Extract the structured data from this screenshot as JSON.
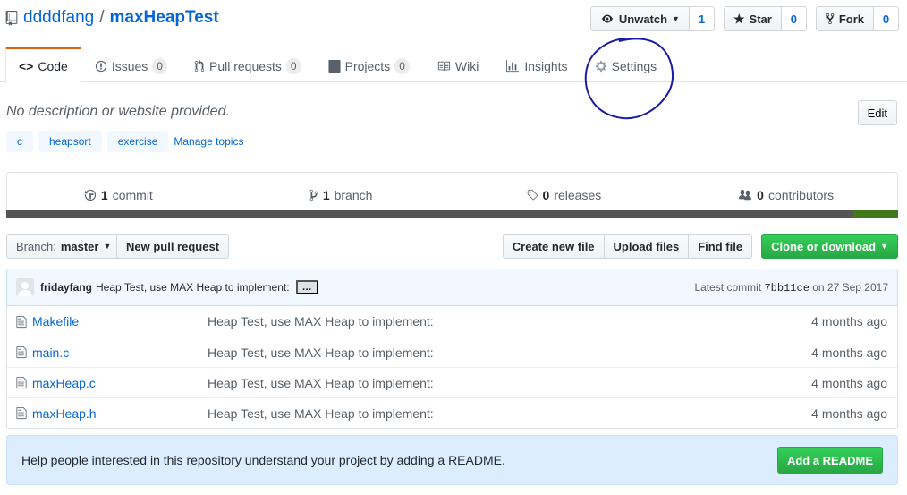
{
  "repo": {
    "owner": "ddddfang",
    "separator": "/",
    "name": "maxHeapTest"
  },
  "actions": {
    "unwatch": {
      "label": "Unwatch",
      "count": "1"
    },
    "star": {
      "label": "Star",
      "count": "0"
    },
    "fork": {
      "label": "Fork",
      "count": "0"
    }
  },
  "tabs": [
    {
      "label": "Code",
      "icon": "code-icon",
      "selected": true
    },
    {
      "label": "Issues",
      "icon": "issue-icon",
      "count": "0"
    },
    {
      "label": "Pull requests",
      "icon": "pull-request-icon",
      "count": "0"
    },
    {
      "label": "Projects",
      "icon": "project-icon",
      "count": "0"
    },
    {
      "label": "Wiki",
      "icon": "book-icon"
    },
    {
      "label": "Insights",
      "icon": "graph-icon"
    },
    {
      "label": "Settings",
      "icon": "gear-icon"
    }
  ],
  "description": "No description or website provided.",
  "edit_label": "Edit",
  "topics": [
    "c",
    "heapsort",
    "exercise"
  ],
  "manage_topics": "Manage topics",
  "summary": {
    "commits": {
      "num": "1",
      "label": "commit"
    },
    "branches": {
      "num": "1",
      "label": "branch"
    },
    "releases": {
      "num": "0",
      "label": "releases"
    },
    "contributors": {
      "num": "0",
      "label": "contributors"
    }
  },
  "language_colors": [
    "#555555",
    "#427819"
  ],
  "file_nav": {
    "branch_label": "Branch:",
    "branch_value": "master",
    "new_pr": "New pull request",
    "create_file": "Create new file",
    "upload_files": "Upload files",
    "find_file": "Find file",
    "clone": "Clone or download"
  },
  "commit": {
    "author": "fridayfang",
    "message": "Heap Test, use MAX Heap to implement:",
    "ellipsis": "…",
    "latest_label": "Latest commit",
    "sha": "7bb11ce",
    "date": "on 27 Sep 2017"
  },
  "files": [
    {
      "name": "Makefile",
      "message": "Heap Test, use MAX Heap to implement:",
      "age": "4 months ago"
    },
    {
      "name": "main.c",
      "message": "Heap Test, use MAX Heap to implement:",
      "age": "4 months ago"
    },
    {
      "name": "maxHeap.c",
      "message": "Heap Test, use MAX Heap to implement:",
      "age": "4 months ago"
    },
    {
      "name": "maxHeap.h",
      "message": "Heap Test, use MAX Heap to implement:",
      "age": "4 months ago"
    }
  ],
  "readme": {
    "text": "Help people interested in this repository understand your project by adding a README.",
    "button": "Add a README"
  }
}
